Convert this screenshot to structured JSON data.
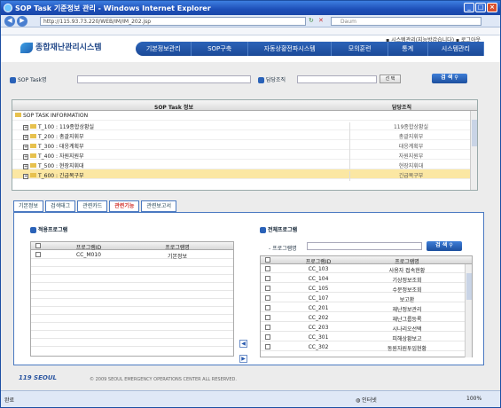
{
  "window": {
    "title": "SOP Task 기준정보 관리 - Windows Internet Explorer"
  },
  "browser": {
    "url": "http://115.93.73.220/WEB/IM/IM_202.jsp",
    "search_placeholder": "Daum"
  },
  "header": {
    "logo": "종합재난관리시스템",
    "toplinks": "▪ 시스템관리(지능방갑습니다)  ▪ 로그아웃",
    "nav": [
      "기본정보관리",
      "SOP구축",
      "자동상황전파시스템",
      "모의훈련",
      "통계",
      "시스템관리"
    ]
  },
  "search": {
    "sop_task_label": "SOP Task명",
    "dept_label": "담당조직",
    "select_button": "선 택",
    "search_button": "검 색"
  },
  "task_grid": {
    "headers": [
      "SOP Task 정보",
      "담당조직"
    ],
    "root": "SOP TASK INFORMATION",
    "rows": [
      {
        "name": "T_100 : 119종합상황실",
        "dept": "119종합상황실"
      },
      {
        "name": "T_200 : 총괄지휘부",
        "dept": "총괄지휘부"
      },
      {
        "name": "T_300 : 대응계획부",
        "dept": "대응계획부"
      },
      {
        "name": "T_400 : 자원지원부",
        "dept": "자원지원부"
      },
      {
        "name": "T_500 : 현장지휘대",
        "dept": "현장지휘대"
      },
      {
        "name": "T_600 : 긴급복구부",
        "dept": "긴급복구부"
      }
    ]
  },
  "tabs": [
    "기본정보",
    "검색태그",
    "관련카드",
    "관련기능",
    "관련보고서"
  ],
  "applied": {
    "title": "적용프로그램",
    "headers": [
      "프로그램ID",
      "프로그램명"
    ],
    "rows": [
      {
        "id": "CC_M010",
        "name": "기본정보"
      }
    ]
  },
  "all_programs": {
    "title": "전체프로그램",
    "filter_label": "- 프로그램명",
    "search_button": "검 색",
    "headers": [
      "프로그램ID",
      "프로그램명"
    ],
    "rows": [
      {
        "id": "CC_103",
        "name": "사용자 접속현황"
      },
      {
        "id": "CC_104",
        "name": "기상정보조회"
      },
      {
        "id": "CC_105",
        "name": "수문정보조회"
      },
      {
        "id": "CC_107",
        "name": "보고환"
      },
      {
        "id": "CC_201",
        "name": "재난정보관리"
      },
      {
        "id": "CC_202",
        "name": "재난그룹등록"
      },
      {
        "id": "CC_203",
        "name": "시나리오선택"
      },
      {
        "id": "CC_301",
        "name": "피해상황보고"
      },
      {
        "id": "CC_302",
        "name": "동원자원투입현황"
      }
    ]
  },
  "move": {
    "left": "◀",
    "right": "▶"
  },
  "footer": {
    "logo": "119 SEOUL",
    "copyright": "© 2009 SEOUL EMERGENCY OPERATIONS CENTER ALL RESERVED."
  },
  "statusbar": {
    "left": "완료",
    "zone": "인터넷",
    "zoom": "100%"
  }
}
